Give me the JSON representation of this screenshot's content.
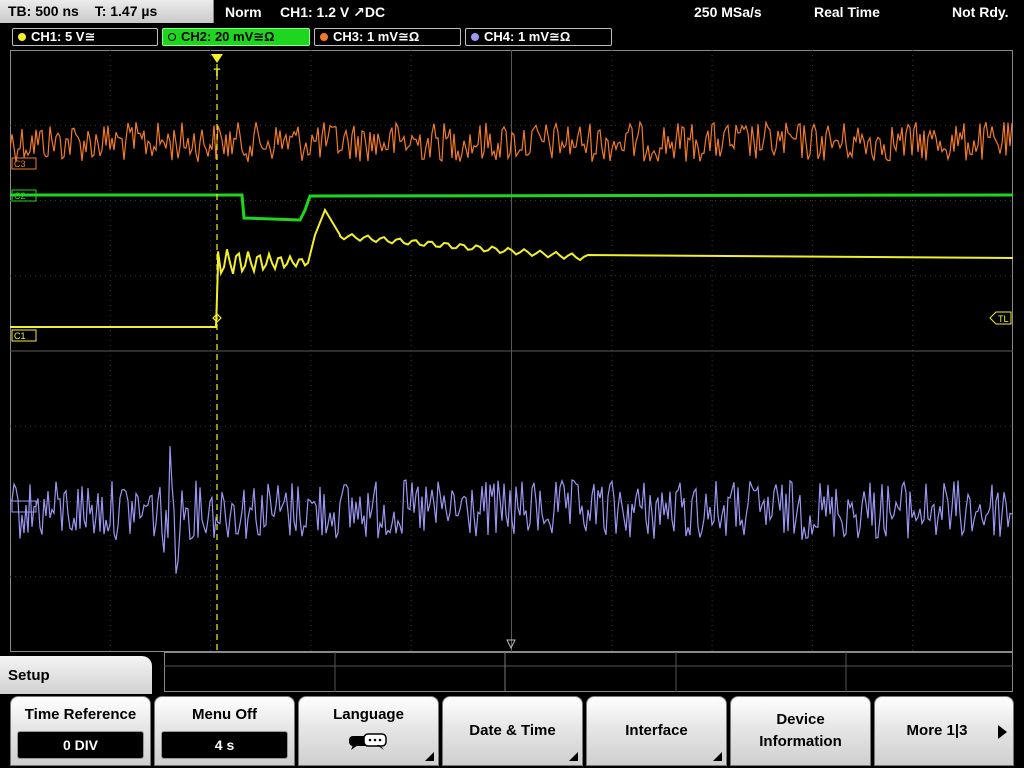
{
  "status": {
    "timebase": "TB: 500 ns",
    "trigger_time": "T: 1.47 µs",
    "mode": "Norm",
    "trigger": "CH1: 1.2 V ↗DC",
    "sample_rate": "250 MSa/s",
    "acquisition": "Real Time",
    "state": "Not Rdy."
  },
  "channels": [
    {
      "label": "CH1: 5 V≅",
      "color": "#f2ef2c"
    },
    {
      "label": "CH2: 20 mV≅Ω",
      "color": "#1fd61f",
      "active": true
    },
    {
      "label": "CH3: 1 mV≅Ω",
      "color": "#f27a28"
    },
    {
      "label": "CH4: 1 mV≅Ω",
      "color": "#9b96f2"
    }
  ],
  "markers": {
    "ch3": "C3",
    "ch2": "C2",
    "ch1": "C1",
    "trigger_level": "TL",
    "trigger_position": "T"
  },
  "menu": {
    "section": "Setup",
    "time_reference": {
      "label": "Time Reference",
      "value": "0 DIV"
    },
    "menu_off": {
      "label": "Menu Off",
      "value": "4 s"
    },
    "language": {
      "label": "Language",
      "icon": "speech-bubbles-icon"
    },
    "date_time": {
      "label": "Date & Time"
    },
    "interface": {
      "label": "Interface"
    },
    "device_information": {
      "line1": "Device",
      "line2": "Information"
    },
    "more": {
      "label": "More 1|3"
    }
  },
  "colors": {
    "ch1": "#f2ef2c",
    "ch2": "#1fd61f",
    "ch3": "#f27a28",
    "ch4": "#9b96f2",
    "grid": "#555555"
  }
}
